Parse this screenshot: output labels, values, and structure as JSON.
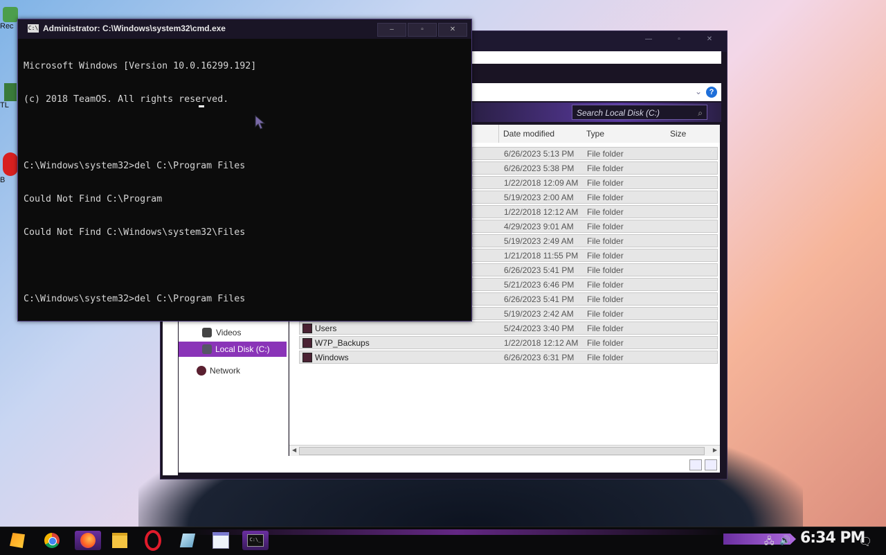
{
  "desktop": {
    "icons": [
      "Rec",
      "TL",
      "B"
    ]
  },
  "explorer": {
    "search_placeholder": "Search Local Disk (C:)",
    "help": "?",
    "columns": [
      "Date modified",
      "Type",
      "Size"
    ],
    "rows": [
      {
        "name": "",
        "date": "6/26/2023 5:13 PM",
        "type": "File folder"
      },
      {
        "name": "",
        "date": "6/26/2023 5:38 PM",
        "type": "File folder"
      },
      {
        "name": "",
        "date": "1/22/2018 12:09 AM",
        "type": "File folder"
      },
      {
        "name": "",
        "date": "5/19/2023 2:00 AM",
        "type": "File folder"
      },
      {
        "name": "",
        "date": "1/22/2018 12:12 AM",
        "type": "File folder"
      },
      {
        "name": "",
        "date": "4/29/2023 9:01 AM",
        "type": "File folder"
      },
      {
        "name": "",
        "date": "5/19/2023 2:49 AM",
        "type": "File folder"
      },
      {
        "name": "",
        "date": "1/21/2018 11:55 PM",
        "type": "File folder"
      },
      {
        "name": "",
        "date": "6/26/2023 5:41 PM",
        "type": "File folder"
      },
      {
        "name": "",
        "date": "5/21/2023 6:46 PM",
        "type": "File folder"
      },
      {
        "name": "",
        "date": "6/26/2023 5:41 PM",
        "type": "File folder"
      },
      {
        "name": "",
        "date": "5/19/2023 2:42 AM",
        "type": "File folder"
      },
      {
        "name": "Users",
        "date": "5/24/2023 3:40 PM",
        "type": "File folder"
      },
      {
        "name": "W7P_Backups",
        "date": "1/22/2018 12:12 AM",
        "type": "File folder"
      },
      {
        "name": "Windows",
        "date": "6/26/2023 6:31 PM",
        "type": "File folder"
      }
    ],
    "nav": [
      "Videos",
      "Local Disk (C:)",
      "Network"
    ]
  },
  "cmd": {
    "title": "Administrator: C:\\Windows\\system32\\cmd.exe",
    "lines": [
      "Microsoft Windows [Version 10.0.16299.192]",
      "(c) 2018 TeamOS. All rights reserved.",
      "",
      "C:\\Windows\\system32>del C:\\Program Files",
      "Could Not Find C:\\Program",
      "Could Not Find C:\\Windows\\system32\\Files",
      "",
      "C:\\Windows\\system32>del C:\\Program Files"
    ],
    "minimize": "–",
    "maximize": "▫",
    "close": "✕"
  },
  "taskbar": {
    "clock": "6:34 PM"
  },
  "colors": {
    "accent": "#8a34b8",
    "console_bg": "#0c0c0c",
    "console_fg": "#d6d6d6"
  }
}
